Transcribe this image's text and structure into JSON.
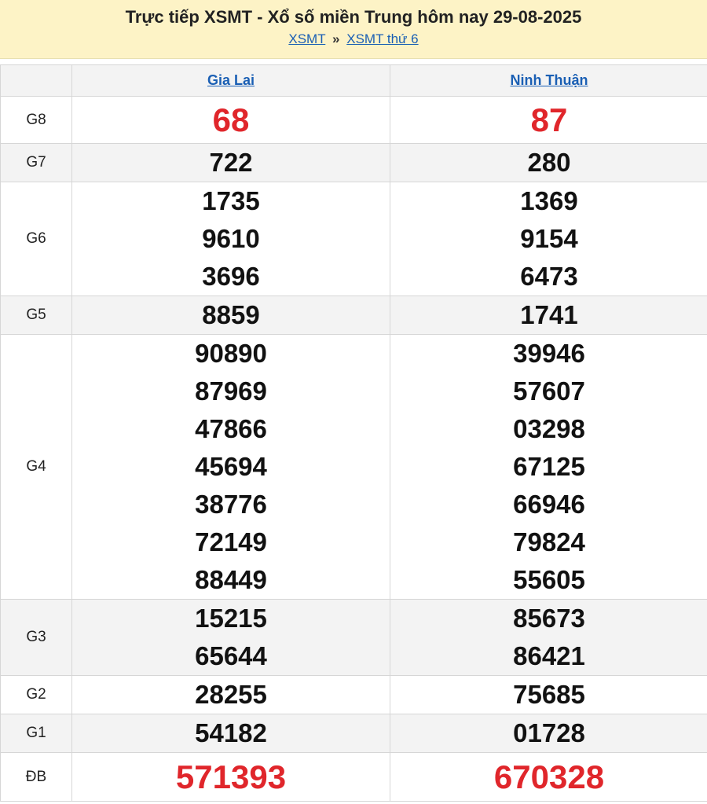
{
  "header": {
    "title": "Trực tiếp XSMT - Xổ số miền Trung hôm nay 29-08-2025",
    "crumb_1": "XSMT",
    "separator": "»",
    "crumb_2": "XSMT thứ 6"
  },
  "provinces": [
    "Gia Lai",
    "Ninh Thuận"
  ],
  "prizes": {
    "g8": {
      "label": "G8",
      "a": [
        "68"
      ],
      "b": [
        "87"
      ]
    },
    "g7": {
      "label": "G7",
      "a": [
        "722"
      ],
      "b": [
        "280"
      ]
    },
    "g6": {
      "label": "G6",
      "a": [
        "1735",
        "9610",
        "3696"
      ],
      "b": [
        "1369",
        "9154",
        "6473"
      ]
    },
    "g5": {
      "label": "G5",
      "a": [
        "8859"
      ],
      "b": [
        "1741"
      ]
    },
    "g4": {
      "label": "G4",
      "a": [
        "90890",
        "87969",
        "47866",
        "45694",
        "38776",
        "72149",
        "88449"
      ],
      "b": [
        "39946",
        "57607",
        "03298",
        "67125",
        "66946",
        "79824",
        "55605"
      ]
    },
    "g3": {
      "label": "G3",
      "a": [
        "15215",
        "65644"
      ],
      "b": [
        "85673",
        "86421"
      ]
    },
    "g2": {
      "label": "G2",
      "a": [
        "28255"
      ],
      "b": [
        "75685"
      ]
    },
    "g1": {
      "label": "G1",
      "a": [
        "54182"
      ],
      "b": [
        "01728"
      ]
    },
    "db": {
      "label": "ĐB",
      "a": [
        "571393"
      ],
      "b": [
        "670328"
      ]
    }
  },
  "colors": {
    "accent_red": "#e0262b",
    "link_blue": "#1a5fb4",
    "header_bg": "#fdf3c6"
  }
}
